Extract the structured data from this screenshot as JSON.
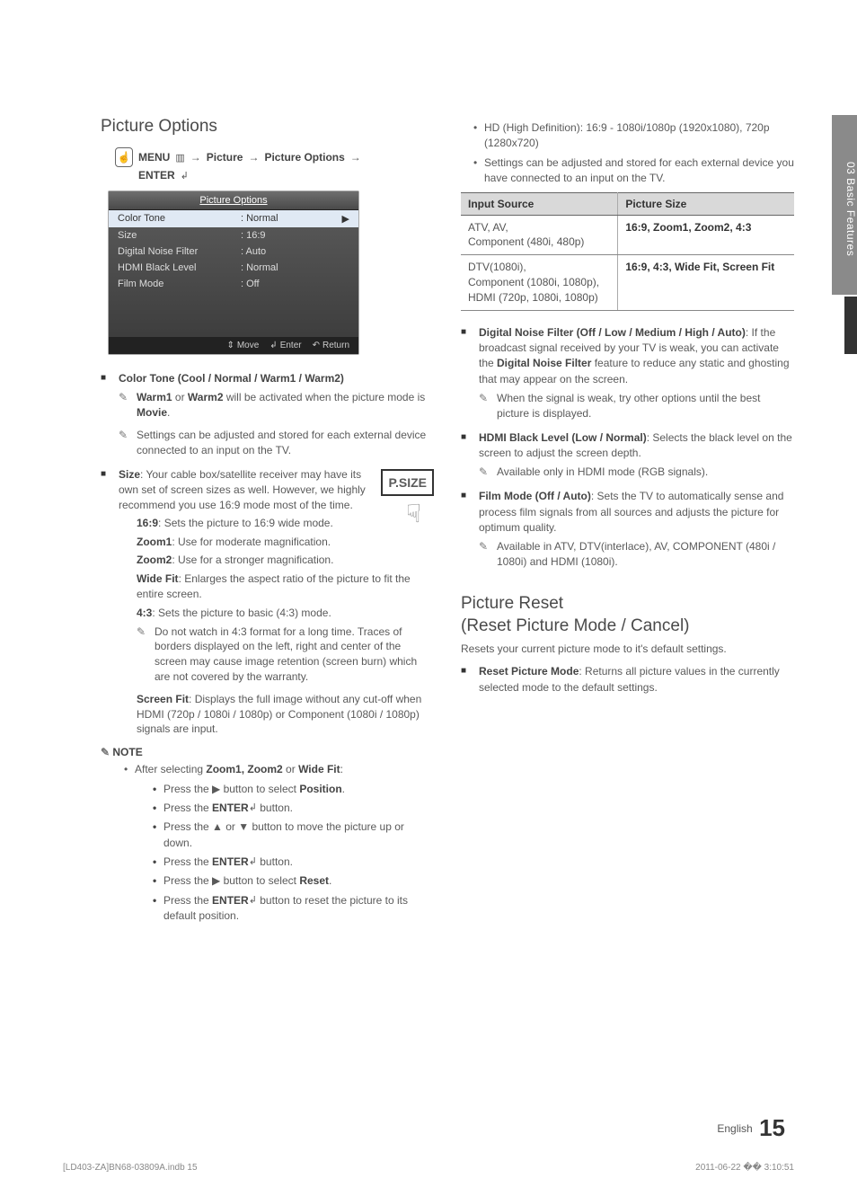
{
  "side_tab": "03 Basic Features",
  "left": {
    "title": "Picture Options",
    "nav": {
      "menu": "MENU",
      "arrow": "→",
      "path1": "Picture",
      "path2": "Picture Options",
      "enter": "ENTER"
    },
    "osd": {
      "title": "Picture Options",
      "rows": [
        {
          "label": "Color Tone",
          "value": ": Normal",
          "selected": true,
          "arrow": "▶"
        },
        {
          "label": "Size",
          "value": ": 16:9"
        },
        {
          "label": "Digital Noise Filter",
          "value": ": Auto"
        },
        {
          "label": "HDMI Black Level",
          "value": ": Normal"
        },
        {
          "label": "Film Mode",
          "value": ": Off"
        }
      ],
      "footer": {
        "move": "Move",
        "enter": "Enter",
        "return": "Return"
      }
    },
    "color_tone": {
      "head": "Color Tone (Cool / Normal / Warm1 / Warm2)",
      "n1_pre": "Warm1",
      "n1_mid": " or ",
      "n1_b2": "Warm2",
      "n1_post": " will be activated when the picture mode is ",
      "n1_end": "Movie",
      "n1_dot": ".",
      "n2": "Settings can be adjusted and stored for each external device connected to an input on the TV."
    },
    "size": {
      "head": "Size",
      "intro": ": Your cable box/satellite receiver may have its own set of screen sizes as well. However, we highly recommend you use 16:9 mode most of the time.",
      "psize_label": "P.SIZE",
      "s169_b": "16:9",
      "s169": ": Sets the picture to 16:9 wide mode.",
      "z1_b": "Zoom1",
      "z1": ": Use for moderate magnification.",
      "z2_b": "Zoom2",
      "z2": ": Use for a stronger magnification.",
      "wf_b": "Wide Fit",
      "wf": ": Enlarges the aspect ratio of the picture to fit the entire screen.",
      "s43_b": "4:3",
      "s43": ": Sets the picture to basic (4:3) mode.",
      "s43_note": "Do not watch in 4:3 format for a long time. Traces of borders displayed on the left, right and center of the screen may cause image retention (screen burn) which are not covered by the warranty.",
      "sf_b": "Screen Fit",
      "sf": ": Displays the full image without any cut-off when HDMI (720p / 1080i / 1080p) or Component (1080i / 1080p) signals are input."
    },
    "note": {
      "head": "NOTE",
      "intro_pre": "After selecting ",
      "intro_b": "Zoom1, Zoom2",
      "intro_mid": " or ",
      "intro_b2": "Wide Fit",
      "intro_end": ":",
      "steps": [
        {
          "pre": "Press the ▶ button to select ",
          "b": "Position",
          "post": "."
        },
        {
          "pre": "Press the ",
          "b": "ENTER",
          "post": " button.",
          "enter": true
        },
        {
          "pre": "Press the ▲ or ▼ button to move the picture up or down."
        },
        {
          "pre": "Press the ",
          "b": "ENTER",
          "post": " button.",
          "enter": true
        },
        {
          "pre": "Press the ▶ button to select ",
          "b": "Reset",
          "post": "."
        },
        {
          "pre": "Press the ",
          "b": "ENTER",
          "post": " button to reset the picture to its default position.",
          "enter": true
        }
      ]
    }
  },
  "right": {
    "top_bullets": [
      "HD (High Definition): 16:9 - 1080i/1080p (1920x1080), 720p (1280x720)",
      "Settings can be adjusted and stored for each external device you have connected to an input on the TV."
    ],
    "table": {
      "h1": "Input Source",
      "h2": "Picture Size",
      "rows": [
        {
          "src": "ATV, AV,\nComponent (480i, 480p)",
          "ps": "16:9, Zoom1, Zoom2, 4:3"
        },
        {
          "src": "DTV(1080i),\nComponent (1080i, 1080p),\nHDMI (720p, 1080i, 1080p)",
          "ps": "16:9, 4:3, Wide Fit, Screen Fit"
        }
      ]
    },
    "dnf": {
      "head": "Digital Noise Filter (Off / Low / Medium / High / Auto)",
      "body_pre": ": If the broadcast signal received by your TV is weak, you can activate the ",
      "body_b": "Digital Noise Filter",
      "body_post": " feature to reduce any static and ghosting that may appear on the screen.",
      "note": "When the signal is weak, try other options until the best picture is displayed."
    },
    "hbl": {
      "head": "HDMI Black Level (Low / Normal)",
      "body": ": Selects the black level on the screen to adjust the screen depth.",
      "note": "Available only in HDMI mode (RGB signals)."
    },
    "film": {
      "head": "Film Mode (Off / Auto)",
      "body": ": Sets the TV to automatically sense and process film signals from all sources and adjusts the picture for optimum quality.",
      "note": "Available in ATV, DTV(interlace), AV, COMPONENT (480i / 1080i) and HDMI (1080i)."
    },
    "reset": {
      "title": "Picture Reset\n(Reset Picture Mode / Cancel)",
      "intro": "Resets your current picture mode to it's default settings.",
      "item_b": "Reset Picture Mode",
      "item": ": Returns all picture values in the currently selected mode to the default settings."
    }
  },
  "footer": {
    "lang": "English",
    "page": "15"
  },
  "print": {
    "left": "[LD403-ZA]BN68-03809A.indb   15",
    "right": "2011-06-22   �� 3:10:51"
  }
}
